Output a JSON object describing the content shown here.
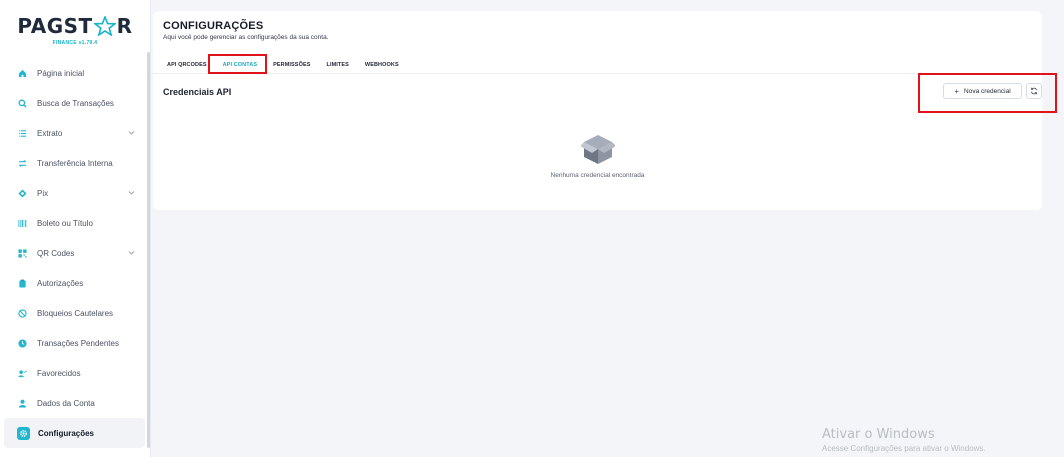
{
  "brand": {
    "logo_left": "PAGST",
    "logo_right": "R",
    "version": "FINANCE v1.79.4",
    "accent_color": "#1aa8c4",
    "highlight_color": "#e0121a"
  },
  "sidebar": {
    "items": [
      {
        "label": "Página inicial",
        "icon": "home-icon"
      },
      {
        "label": "Busca de Transações",
        "icon": "search-icon"
      },
      {
        "label": "Extrato",
        "icon": "list-icon",
        "expandable": true
      },
      {
        "label": "Transferência Interna",
        "icon": "transfer-icon"
      },
      {
        "label": "Pix",
        "icon": "pix-icon",
        "expandable": true
      },
      {
        "label": "Boleto ou Título",
        "icon": "barcode-icon"
      },
      {
        "label": "QR Codes",
        "icon": "qrcode-icon",
        "expandable": true
      },
      {
        "label": "Autorizações",
        "icon": "clipboard-icon"
      },
      {
        "label": "Bloqueios Cautelares",
        "icon": "block-icon"
      },
      {
        "label": "Transações Pendentes",
        "icon": "clock-icon"
      },
      {
        "label": "Favorecidos",
        "icon": "users-icon"
      },
      {
        "label": "Dados da Conta",
        "icon": "user-icon"
      },
      {
        "label": "Configurações",
        "icon": "gear-icon",
        "active": true
      }
    ]
  },
  "header": {
    "title": "CONFIGURAÇÕES",
    "subtitle": "Aqui você pode gerenciar as configurações da sua conta."
  },
  "tabs": [
    {
      "label": "API QRCODES"
    },
    {
      "label": "API CONTAS",
      "active": true
    },
    {
      "label": "PERMISSÕES"
    },
    {
      "label": "LIMITES"
    },
    {
      "label": "WEBHOOKS"
    }
  ],
  "section": {
    "title": "Credenciais API",
    "new_button": "Nova credencial",
    "refresh_icon": "refresh-icon",
    "empty_text": "Nenhuma credencial encontrada",
    "empty_icon": "empty-box-icon"
  },
  "watermark": {
    "title": "Ativar o Windows",
    "subtitle": "Acesse Configurações para ativar o Windows."
  }
}
